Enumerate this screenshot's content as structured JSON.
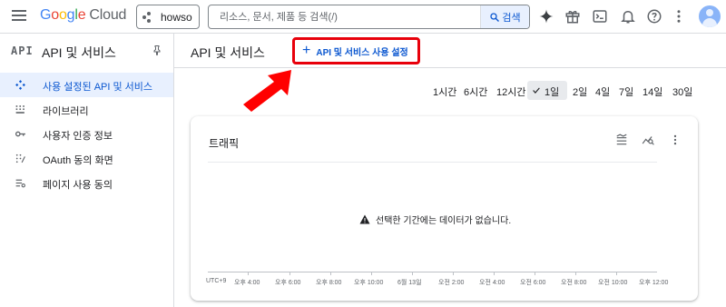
{
  "topbar": {
    "logo_letters": [
      "G",
      "o",
      "o",
      "g",
      "l",
      "e"
    ],
    "logo_product": "Cloud",
    "project_name": "howso",
    "search_placeholder": "리소스, 문서, 제품 등 검색(/)",
    "search_button_label": "검색",
    "icons": [
      "menu-icon",
      "gemini-icon",
      "gift-icon",
      "cloud-shell-icon",
      "notifications-icon",
      "help-icon",
      "more-vert-icon",
      "account-avatar"
    ]
  },
  "sidebar": {
    "glyph": "API",
    "title": "API 및 서비스",
    "items": [
      {
        "label": "사용 설정된 API 및 서비스",
        "icon": "enabled-apis-icon",
        "active": true
      },
      {
        "label": "라이브러리",
        "icon": "library-icon",
        "active": false
      },
      {
        "label": "사용자 인증 정보",
        "icon": "key-icon",
        "active": false
      },
      {
        "label": "OAuth 동의 화면",
        "icon": "consent-icon",
        "active": false
      },
      {
        "label": "페이지 사용 동의",
        "icon": "page-usage-icon",
        "active": false
      }
    ]
  },
  "main": {
    "title": "API 및 서비스",
    "enable_button_label": "API 및 서비스 사용 설정",
    "time_ranges": [
      "1시간",
      "6시간",
      "12시간",
      "1일",
      "2일",
      "4일",
      "7일",
      "14일",
      "30일"
    ],
    "selected_time_range": "1일",
    "card": {
      "title": "트래픽",
      "empty_message": "선택한 기간에는 데이터가 없습니다.",
      "axis_labels": [
        "UTC+9",
        "오후 4:00",
        "오후 6:00",
        "오후 8:00",
        "오후 10:00",
        "6월 13일",
        "오전 2:00",
        "오전 4:00",
        "오전 6:00",
        "오전 8:00",
        "오전 10:00",
        "오후 12:00"
      ]
    }
  },
  "colors": {
    "accent": "#0b57d0",
    "active_bg": "#e8f0fe",
    "highlight_border": "#e8000b",
    "annotation_arrow": "#ff0000"
  }
}
